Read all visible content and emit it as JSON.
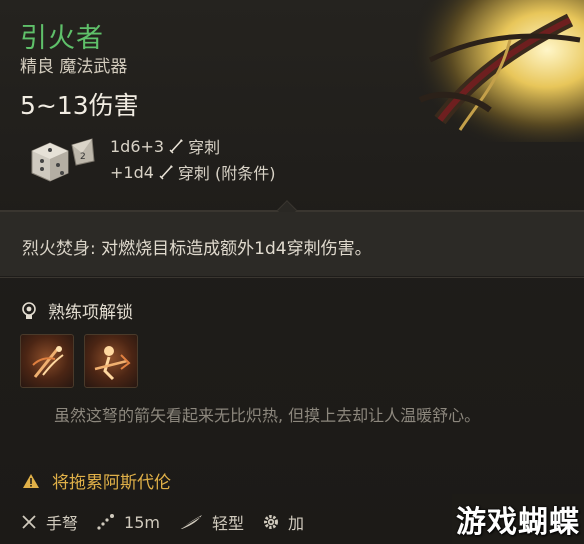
{
  "item": {
    "name": "引火者",
    "subtitle": "精良 魔法武器",
    "damage": "5~13伤害",
    "rolls": [
      {
        "formula": "1d6+3",
        "type": "穿刺"
      },
      {
        "formula": "+1d4",
        "type": "穿刺 (附条件)"
      }
    ]
  },
  "passive": {
    "name": "烈火焚身:",
    "description": "对燃烧目标造成额外1d4穿刺伤害。"
  },
  "proficiency": {
    "heading": "熟练项解锁",
    "tiles": [
      "proficiency-tile-1",
      "proficiency-tile-2"
    ]
  },
  "flavor": "虽然这弩的箭矢看起来无比炽热, 但摸上去却让人温暖舒心。",
  "warning": "将拖累阿斯代伦",
  "footer": {
    "weapon_type": "手弩",
    "range": "15m",
    "weight_class": "轻型",
    "extra": "加"
  },
  "watermark": "游戏蝴蝶",
  "colors": {
    "name_green": "#5fc06a",
    "warning_yellow": "#e0b048",
    "flavor_gray": "#8c877d"
  }
}
